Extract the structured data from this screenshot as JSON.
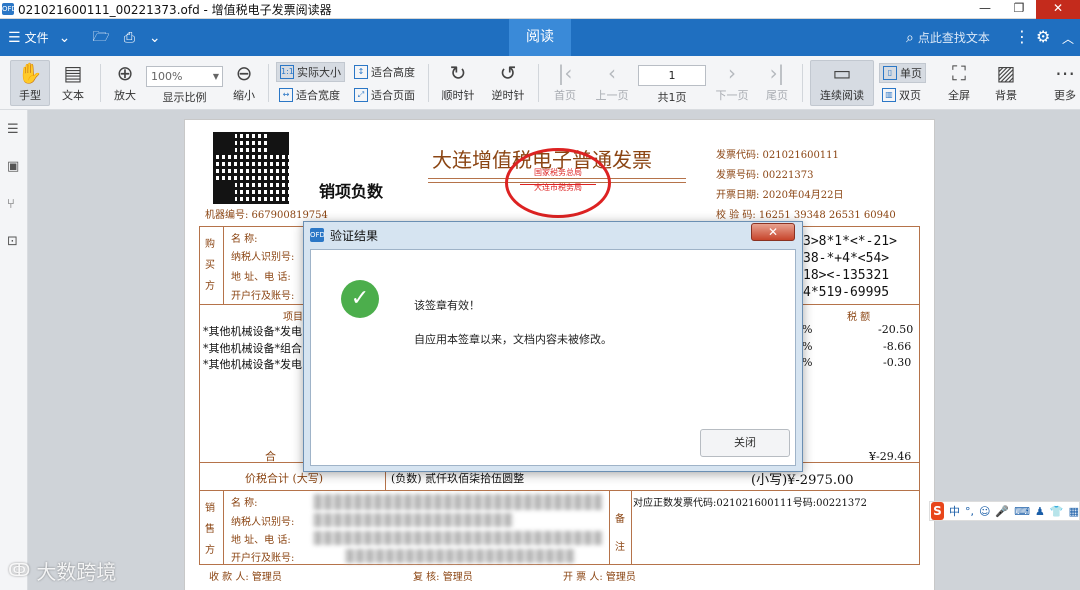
{
  "window": {
    "title": "021021600111_00221373.ofd - 增值税电子发票阅读器",
    "app_icon": "OFD"
  },
  "menubar": {
    "file_label": "文件",
    "read_tab": "阅读",
    "search_placeholder": "点此查找文本"
  },
  "toolbar": {
    "hand": "手型",
    "text": "文本",
    "zoom_in": "放大",
    "zoom_value": "100%",
    "zoom_ratio": "显示比例",
    "zoom_out": "缩小",
    "actual_size": "实际大小",
    "fit_height": "适合高度",
    "fit_width": "适合宽度",
    "fit_page": "适合页面",
    "rotate_cw": "顺时针",
    "rotate_ccw": "逆时针",
    "first_page": "首页",
    "prev_page": "上一页",
    "page_number": "1",
    "total_pages": "共1页",
    "next_page": "下一页",
    "last_page": "尾页",
    "continuous": "连续阅读",
    "single_page": "单页",
    "double_page": "双页",
    "fullscreen": "全屏",
    "background": "背景",
    "more": "更多"
  },
  "invoice": {
    "title": "大连增值税电子普通发票",
    "subtitle": "销项负数",
    "machine_no": "机器编号: 667900819754",
    "code": "发票代码: 021021600111",
    "number": "发票号码: 00221373",
    "date": "开票日期: 2020年04月22日",
    "check_code": "校 验 码: 16251 39348 26531 60940",
    "seal_top": "国家税务总局",
    "seal_bottom": "大连市税务局",
    "buyer_label": "购买方",
    "buyer_fields": [
      "名    称:",
      "纳税人识别号:",
      "地 址、电 话:",
      "开户行及账号:"
    ],
    "cipher": [
      "3>8*1*<*-21>",
      "38-*+4*<54>",
      "18><-135321",
      "4*519-69995"
    ],
    "items_header": "项目名称",
    "tax_header": "税   额",
    "items": [
      "*其他机械设备*发电",
      "*其他机械设备*组合",
      "*其他机械设备*发电"
    ],
    "percents": [
      "%",
      "%",
      "%"
    ],
    "taxes": [
      "-20.50",
      "-8.66",
      "-0.30"
    ],
    "total_label": "合",
    "total_tax": "¥-29.46",
    "sum_label": "价税合计 (大写)",
    "sum_text": "(负数) 贰仟玖佰柒拾伍圆整",
    "sum_small": "(小写)¥-2975.00",
    "seller_label": "销售方",
    "seller_fields": [
      "名    称:",
      "纳税人识别号:",
      "地 址、电 话:",
      "开户行及账号:"
    ],
    "remark_label": "备注",
    "remark_text": "对应正数发票代码:021021600111号码:00221372",
    "payee": "收 款 人: 管理员",
    "reviewer": "复   核: 管理员",
    "drawer": "开 票 人: 管理员"
  },
  "dialog": {
    "title": "验证结果",
    "message1": "该签章有效！",
    "message2": "自应用本签章以来，文档内容未被修改。",
    "close_button": "关闭"
  },
  "ime": {
    "logo": "S",
    "lang": "中"
  },
  "watermark": "大数跨境"
}
